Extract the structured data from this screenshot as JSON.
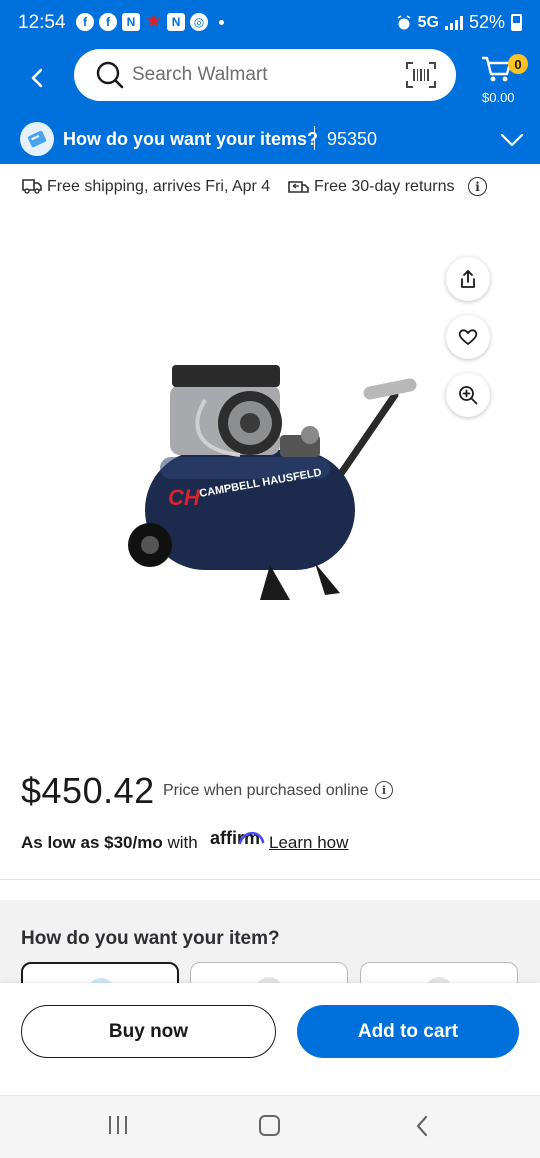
{
  "status_bar": {
    "time": "12:54",
    "network": "5G",
    "battery": "52%",
    "notification_icons": [
      "facebook-icon",
      "facebook-icon",
      "n-app-icon",
      "star-icon",
      "n-app-icon",
      "settings-app-icon"
    ]
  },
  "header": {
    "search_placeholder": "Search Walmart",
    "cart_count": "0",
    "cart_total": "$0.00"
  },
  "delivery": {
    "prompt": "How do you want your items?",
    "zip": "95350"
  },
  "info_row": {
    "shipping": "Free shipping, arrives Fri, Apr 4",
    "returns": "Free 30-day returns"
  },
  "product": {
    "image_brand_text": "CAMPBELL HAUSFELD",
    "image_logo_letters": "CH"
  },
  "pricing": {
    "price": "$450.42",
    "price_note": "Price when purchased online",
    "as_low_prefix": "As low as ",
    "as_low_amount": "$30/mo",
    "as_low_suffix": " with",
    "affirm": "affirm",
    "learn_how": "Learn how"
  },
  "fulfillment": {
    "title": "How do you want your item?"
  },
  "actions": {
    "buy_now": "Buy now",
    "add_to_cart": "Add to cart"
  },
  "colors": {
    "walmart_blue": "#0071dc",
    "spark_yellow": "#ffc220"
  }
}
